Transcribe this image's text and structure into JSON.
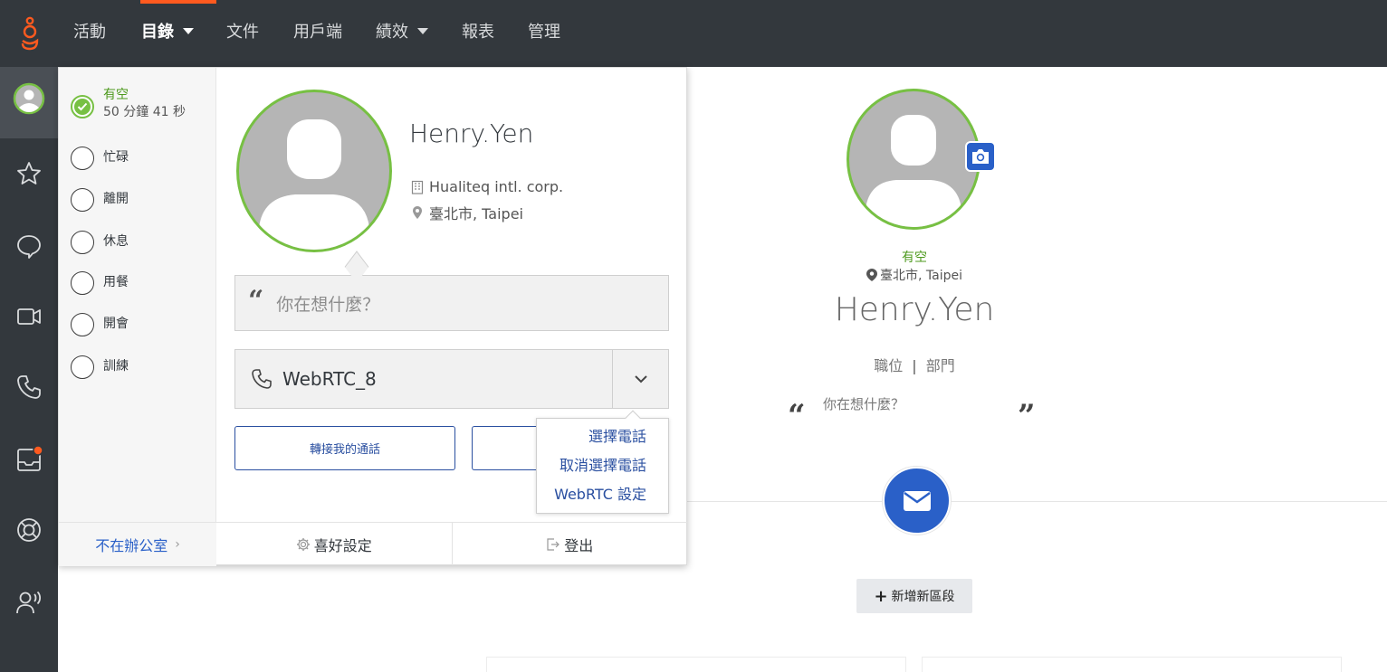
{
  "nav": {
    "items": [
      {
        "label": "活動",
        "active": false,
        "dropdown": false
      },
      {
        "label": "目錄",
        "active": true,
        "dropdown": true
      },
      {
        "label": "文件",
        "active": false,
        "dropdown": false
      },
      {
        "label": "用戶端",
        "active": false,
        "dropdown": false
      },
      {
        "label": "績效",
        "active": false,
        "dropdown": true
      },
      {
        "label": "報表",
        "active": false,
        "dropdown": false
      },
      {
        "label": "管理",
        "active": false,
        "dropdown": false
      }
    ],
    "accent_color": "#ff5a1f",
    "background_color": "#33383d"
  },
  "rail": {
    "icons": [
      "user-avatar-icon",
      "star-icon",
      "chat-bubble-icon",
      "video-icon",
      "phone-icon",
      "inbox-icon",
      "lifebuoy-icon",
      "speaking-user-icon"
    ],
    "inbox_has_notification": true
  },
  "presence": {
    "statuses": [
      {
        "label": "有空",
        "sub": "50 分鐘 41 秒",
        "selected": true
      },
      {
        "label": "忙碌",
        "selected": false
      },
      {
        "label": "離開",
        "selected": false
      },
      {
        "label": "休息",
        "selected": false
      },
      {
        "label": "用餐",
        "selected": false
      },
      {
        "label": "開會",
        "selected": false
      },
      {
        "label": "訓練",
        "selected": false
      }
    ],
    "out_of_office_label": "不在辦公室",
    "available_color": "#77c043"
  },
  "popover": {
    "name": "Henry.Yen",
    "company": "Hualiteq intl. corp.",
    "location": "臺北市, Taipei",
    "thought_placeholder": "你在想什麼？",
    "phone_value": "WebRTC_8",
    "transfer_calls_label": "轉接我的通話",
    "phone_menu": [
      "選擇電話",
      "取消選擇電話",
      "WebRTC 設定"
    ],
    "preferences_label": "喜好設定",
    "logout_label": "登出"
  },
  "profile": {
    "status": "有空",
    "location": "臺北市, Taipei",
    "name": "Henry.Yen",
    "title_label": "職位",
    "department_label": "部門",
    "separator": "|",
    "thought_placeholder": "你在想什麼？",
    "add_section_label": "新增新區段",
    "link_color": "#2a60c8"
  }
}
